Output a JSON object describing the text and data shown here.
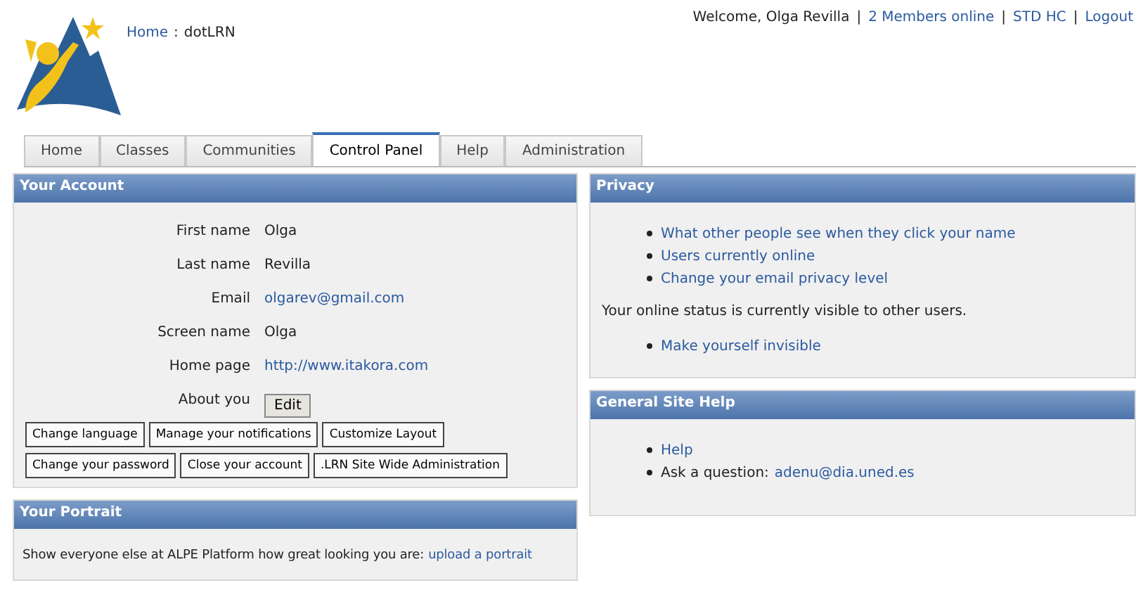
{
  "breadcrumb": [
    {
      "text": "Home",
      "kind": "link"
    },
    {
      "text": ":",
      "kind": "text"
    },
    {
      "text": "dotLRN",
      "kind": "text"
    }
  ],
  "user_bar": [
    {
      "text": "Welcome, Olga Revilla",
      "kind": "text"
    },
    {
      "text": "|",
      "kind": "separator"
    },
    {
      "text": "2 Members online",
      "kind": "link"
    },
    {
      "text": "|",
      "kind": "separator"
    },
    {
      "text": "STD HC",
      "kind": "link"
    },
    {
      "text": "|",
      "kind": "separator"
    },
    {
      "text": "Logout",
      "kind": "link"
    }
  ],
  "tabs": [
    {
      "label": "Home",
      "selected": false
    },
    {
      "label": "Classes",
      "selected": false
    },
    {
      "label": "Communities",
      "selected": false
    },
    {
      "label": "Control Panel",
      "selected": true
    },
    {
      "label": "Help",
      "selected": false
    },
    {
      "label": "Administration",
      "selected": false
    }
  ],
  "your_account": {
    "title": "Your Account",
    "fields": [
      {
        "label": "First name",
        "value": "Olga",
        "kind": "text"
      },
      {
        "label": "Last name",
        "value": "Revilla",
        "kind": "text"
      },
      {
        "label": "Email",
        "value": "olgarev@gmail.com",
        "kind": "link"
      },
      {
        "label": "Screen name",
        "value": "Olga",
        "kind": "text"
      },
      {
        "label": "Home page",
        "value": "http://www.itakora.com",
        "kind": "link"
      },
      {
        "label": "About you",
        "value": "Edit",
        "kind": "button"
      }
    ],
    "button_rows": [
      [
        "Change language",
        "Manage your notifications",
        "Customize Layout"
      ],
      [
        "Change your password",
        "Close your account",
        ".LRN Site Wide Administration"
      ]
    ]
  },
  "your_portrait": {
    "title": "Your Portrait",
    "text": "Show everyone else at ALPE Platform how great looking you are:",
    "link": "upload a portrait"
  },
  "privacy": {
    "title": "Privacy",
    "links": [
      "What other people see when they click your name",
      "Users currently online",
      "Change your email privacy level"
    ],
    "status": "Your online status is currently visible to other users.",
    "status_links": [
      "Make yourself invisible"
    ]
  },
  "site_help": {
    "title": "General Site Help",
    "items": [
      {
        "link": "Help"
      },
      {
        "label": "Ask a question:",
        "link": "adenu@dia.uned.es"
      }
    ]
  }
}
